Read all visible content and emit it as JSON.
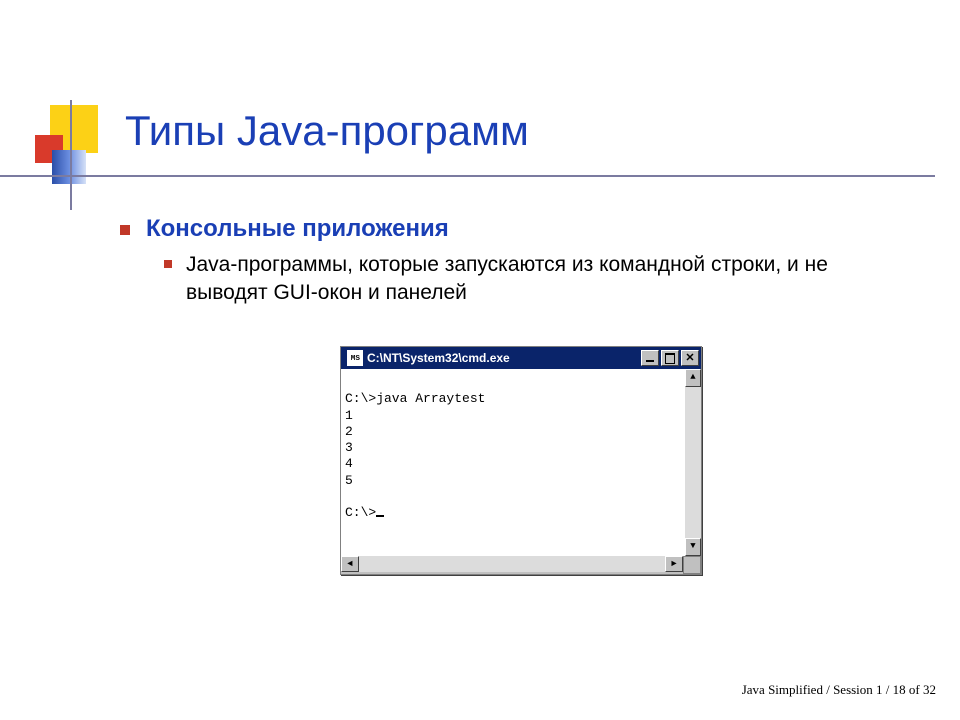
{
  "title": "Типы Java-программ",
  "bullets": {
    "lvl1": "Консольные приложения",
    "lvl2": "Java-программы, которые запускаются из командной строки, и не выводят GUI-окон и панелей"
  },
  "cmd": {
    "icon_label": "MS",
    "title": "C:\\NT\\System32\\cmd.exe",
    "close_glyph": "✕",
    "up_glyph": "▲",
    "down_glyph": "▼",
    "left_glyph": "◄",
    "right_glyph": "►",
    "lines": [
      "",
      "C:\\>java Arraytest",
      "1",
      "2",
      "3",
      "4",
      "5",
      "",
      "C:\\>"
    ]
  },
  "footer": "Java Simplified /  Session 1 / 18 of 32"
}
